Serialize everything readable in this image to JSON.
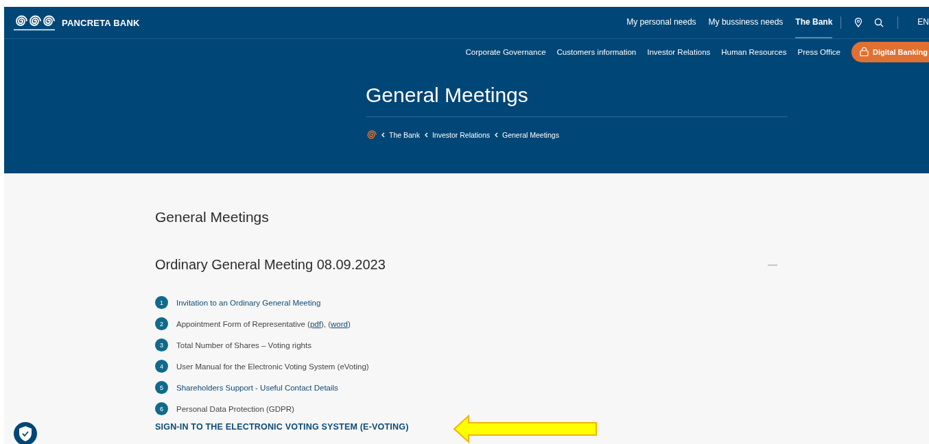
{
  "brand": {
    "name": "PANCRETA BANK"
  },
  "top_nav": [
    {
      "label": "My personal needs",
      "selected": false
    },
    {
      "label": "My bussiness needs",
      "selected": false
    },
    {
      "label": "The Bank",
      "selected": true
    }
  ],
  "language": "EN",
  "sub_nav": [
    "Corporate Governance",
    "Customers information",
    "Investor Relations",
    "Human Resources",
    "Press Office"
  ],
  "digital_banking_button": "Digital Banking",
  "hero": {
    "title": "General Meetings",
    "breadcrumb": [
      "The Bank",
      "Investor Relations",
      "General Meetings"
    ]
  },
  "content": {
    "title": "General Meetings",
    "meeting": {
      "title": "Ordinary General Meeting 08.09.2023",
      "expanded": true,
      "items": [
        {
          "number": "1",
          "parts": [
            {
              "kind": "link",
              "text": "Invitation to an Ordinary General Meeting"
            }
          ]
        },
        {
          "number": "2",
          "parts": [
            {
              "kind": "text",
              "text": "Appointment Form of Representative ("
            },
            {
              "kind": "inline_link",
              "text": "pdf"
            },
            {
              "kind": "text",
              "text": "), ("
            },
            {
              "kind": "inline_link",
              "text": "word"
            },
            {
              "kind": "text",
              "text": ")"
            }
          ]
        },
        {
          "number": "3",
          "parts": [
            {
              "kind": "text",
              "text": "Total Number of Shares – Voting rights"
            }
          ]
        },
        {
          "number": "4",
          "parts": [
            {
              "kind": "text",
              "text": "User Manual for the Electronic Voting System (eVoting)"
            }
          ]
        },
        {
          "number": "5",
          "parts": [
            {
              "kind": "link",
              "text": "Shareholders Support - Useful Contact Details"
            }
          ]
        },
        {
          "number": "6",
          "parts": [
            {
              "kind": "text",
              "text": "Personal Data Protection (GDPR)"
            }
          ]
        }
      ],
      "sign_in_link": "SIGN-IN TO THE ELECTRONIC VOTING SYSTEM (E-VOTING)"
    }
  }
}
